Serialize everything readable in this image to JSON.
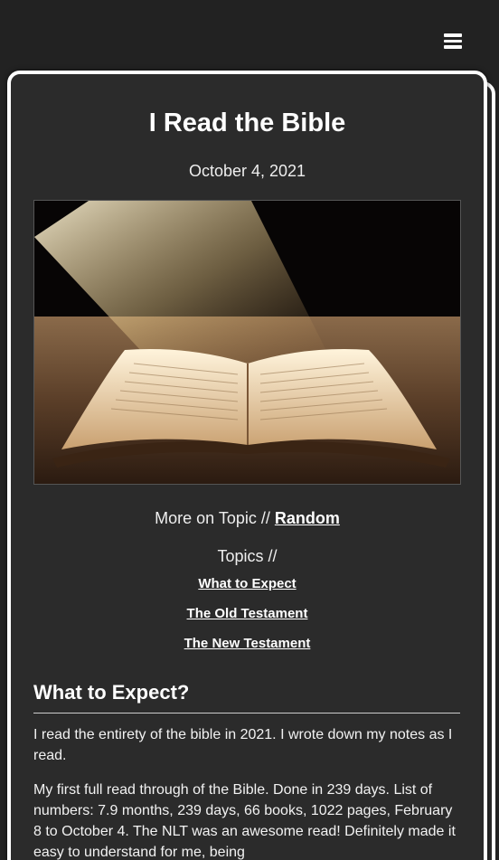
{
  "nav": {
    "menu_icon": "hamburger-menu-icon"
  },
  "post": {
    "title": "I Read the Bible",
    "date": "October 4, 2021",
    "image_alt": "Open book in a beam of light"
  },
  "more_on_topic": {
    "label": "More on Topic // ",
    "link": "Random"
  },
  "topics": {
    "label": "Topics //",
    "links": [
      "What to Expect",
      "The Old Testament",
      "The New Testament"
    ]
  },
  "section": {
    "heading": "What to Expect?",
    "paragraphs": [
      "I read the entirety of the bible in 2021. I wrote down my notes as I read.",
      "My first full read through of the Bible. Done in 239 days. List of numbers: 7.9 months, 239 days, 66 books, 1022 pages, February 8 to October 4. The NLT was an awesome read! Definitely made it easy to understand for me, being"
    ]
  },
  "colors": {
    "background": "#222222",
    "card": "#2b2b2b",
    "border": "#ffffff",
    "text": "#f2f2f2"
  }
}
